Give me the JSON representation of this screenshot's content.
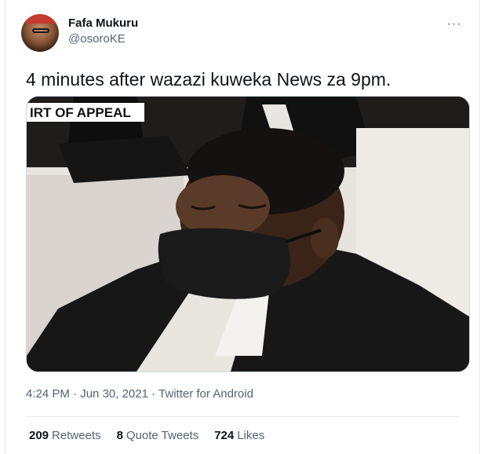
{
  "author": {
    "display_name": "Fafa Mukuru",
    "handle": "@osoroKE"
  },
  "menu_icon": "more-horizontal-icon",
  "tweet": {
    "text": "4 minutes after wazazi kuweka News za 9pm.",
    "media_caption": "IRT OF APPEAL",
    "time": "4:24 PM",
    "date": "Jun 30, 2021",
    "separator": "·",
    "source": "Twitter for Android"
  },
  "stats": {
    "retweets_count": "209",
    "retweets_label": "Retweets",
    "quotes_count": "8",
    "quotes_label": "Quote Tweets",
    "likes_count": "724",
    "likes_label": "Likes"
  },
  "colors": {
    "text_primary": "#0f1419",
    "text_secondary": "#536471",
    "border": "#e6e9eb"
  }
}
